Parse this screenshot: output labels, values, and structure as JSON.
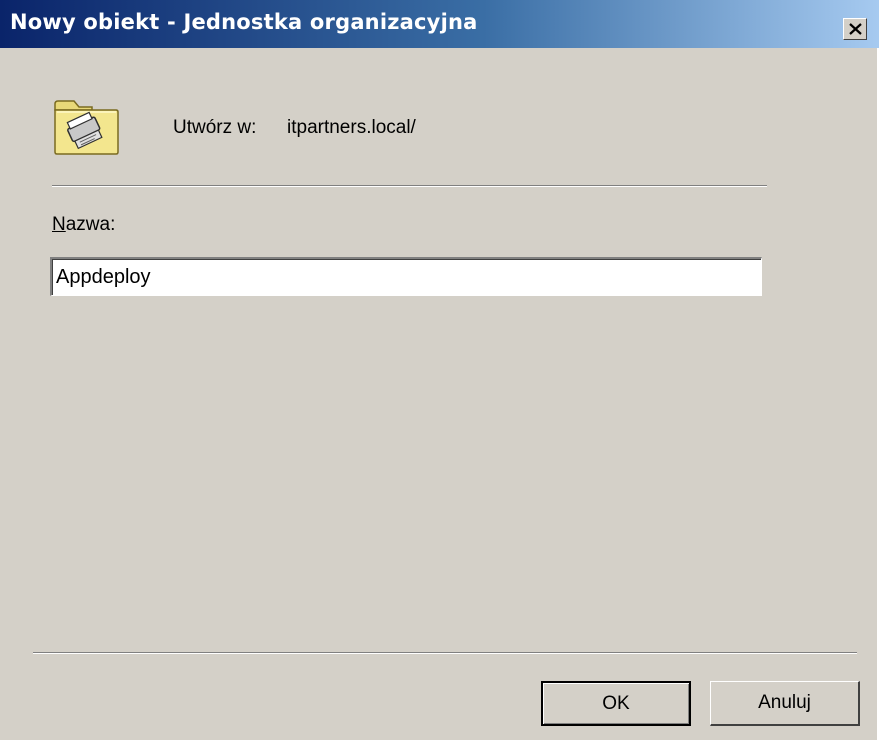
{
  "window": {
    "title": "Nowy obiekt - Jednostka organizacyjna",
    "close_icon": "close-icon"
  },
  "header": {
    "icon": "ou-folder-icon",
    "create_in_label": "Utwórz w:",
    "create_in_value": "itpartners.local/"
  },
  "form": {
    "name_label_accel": "N",
    "name_label_rest": "azwa:",
    "name_value": "Appdeploy"
  },
  "buttons": {
    "ok": "OK",
    "cancel": "Anuluj"
  },
  "colors": {
    "titlebar_start": "#0a246a",
    "titlebar_end": "#a6caf0",
    "dialog_face": "#d4d0c8"
  }
}
